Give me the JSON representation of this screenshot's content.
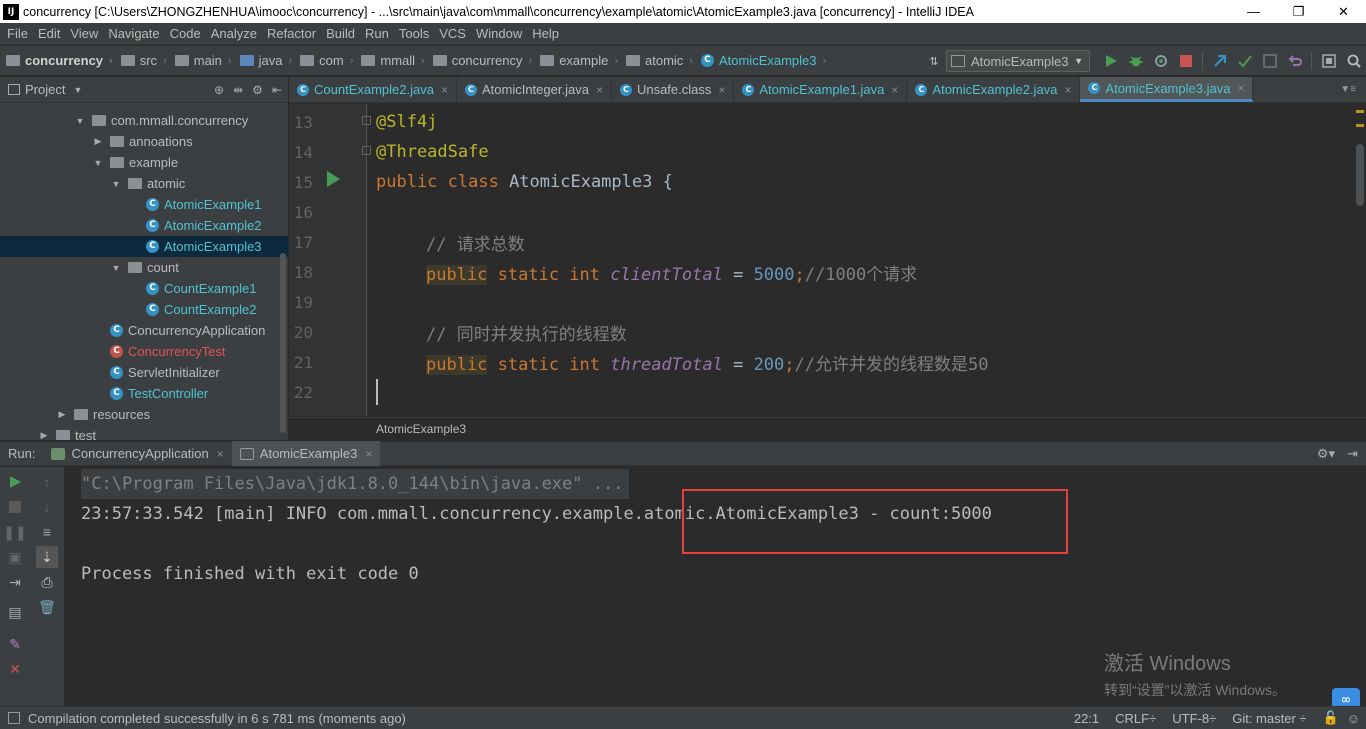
{
  "window": {
    "app_icon": "IJ",
    "title": "concurrency [C:\\Users\\ZHONGZHENHUA\\imooc\\concurrency] - ...\\src\\main\\java\\com\\mmall\\concurrency\\example\\atomic\\AtomicExample3.java [concurrency] - IntelliJ IDEA",
    "minimize": "—",
    "restore": "❐",
    "close": "✕"
  },
  "menu": [
    "File",
    "Edit",
    "View",
    "Navigate",
    "Code",
    "Analyze",
    "Refactor",
    "Build",
    "Run",
    "Tools",
    "VCS",
    "Window",
    "Help"
  ],
  "breadcrumb": [
    "concurrency",
    "src",
    "main",
    "java",
    "com",
    "mmall",
    "concurrency",
    "example",
    "atomic",
    "AtomicExample3"
  ],
  "run_config": "AtomicExample3",
  "project_panel": {
    "title": "Project",
    "tree": [
      {
        "label": "com.mmall.concurrency",
        "type": "package"
      },
      {
        "label": "annoations",
        "type": "package"
      },
      {
        "label": "example",
        "type": "package"
      },
      {
        "label": "atomic",
        "type": "package"
      },
      {
        "label": "AtomicExample1",
        "type": "class"
      },
      {
        "label": "AtomicExample2",
        "type": "class"
      },
      {
        "label": "AtomicExample3",
        "type": "class"
      },
      {
        "label": "count",
        "type": "package"
      },
      {
        "label": "CountExample1",
        "type": "class"
      },
      {
        "label": "CountExample2",
        "type": "class"
      },
      {
        "label": "ConcurrencyApplication",
        "type": "class"
      },
      {
        "label": "ConcurrencyTest",
        "type": "test"
      },
      {
        "label": "ServletInitializer",
        "type": "class"
      },
      {
        "label": "TestController",
        "type": "class"
      },
      {
        "label": "resources",
        "type": "folder"
      },
      {
        "label": "test",
        "type": "folder"
      }
    ]
  },
  "editor_tabs": [
    {
      "label": "CountExample2.java",
      "color": "#4fc3d1"
    },
    {
      "label": "AtomicInteger.java",
      "color": "#bbbbbb"
    },
    {
      "label": "Unsafe.class",
      "color": "#bbbbbb"
    },
    {
      "label": "AtomicExample1.java",
      "color": "#4fc3d1"
    },
    {
      "label": "AtomicExample2.java",
      "color": "#4fc3d1"
    },
    {
      "label": "AtomicExample3.java",
      "color": "#4fc3d1"
    }
  ],
  "tab_close": "×",
  "code": {
    "line_numbers": [
      "13",
      "14",
      "15",
      "16",
      "17",
      "18",
      "19",
      "20",
      "21",
      "22"
    ],
    "l13": "@Slf4j",
    "l14": "@ThreadSafe",
    "l15_kw": "public class",
    "l15_rest": " AtomicExample3 {",
    "l17": "// 请求总数",
    "l18_kw1": "public",
    "l18_kw2": " static int ",
    "l18_field": "clientTotal",
    "l18_eq": " = ",
    "l18_num": "5000",
    "l18_semi": ";",
    "l18_cmt": "//1000个请求",
    "l20": "// 同时并发执行的线程数",
    "l21_kw1": "public",
    "l21_kw2": " static int ",
    "l21_field": "threadTotal",
    "l21_eq": " = ",
    "l21_num": "200",
    "l21_semi": ";",
    "l21_cmt": "//允许并发的线程数是50"
  },
  "editor_breadcrumb": "AtomicExample3",
  "run_panel": {
    "label": "Run:",
    "tabs": [
      "ConcurrencyApplication",
      "AtomicExample3"
    ],
    "console": {
      "cmd": "\"C:\\Program Files\\Java\\jdk1.8.0_144\\bin\\java.exe\" ...",
      "log": "23:57:33.542 [main] INFO com.mmall.concurrency.example.atomic.AtomicExample3 - count:5000",
      "exit": "Process finished with exit code 0"
    }
  },
  "watermark": {
    "line1": "激活 Windows",
    "line2": "转到“设置”以激活 Windows。"
  },
  "status": {
    "message": "Compilation completed successfully in 6 s 781 ms (moments ago)",
    "position": "22:1",
    "line_sep": "CRLF÷",
    "encoding": "UTF-8÷",
    "vcs": "Git: master ÷"
  },
  "colors": {
    "accent_tab": "#4a88c7",
    "class_name": "#4fc3d1",
    "test_class": "#e2535c",
    "highlight_box": "#e2413c",
    "run_green": "#499c54"
  }
}
